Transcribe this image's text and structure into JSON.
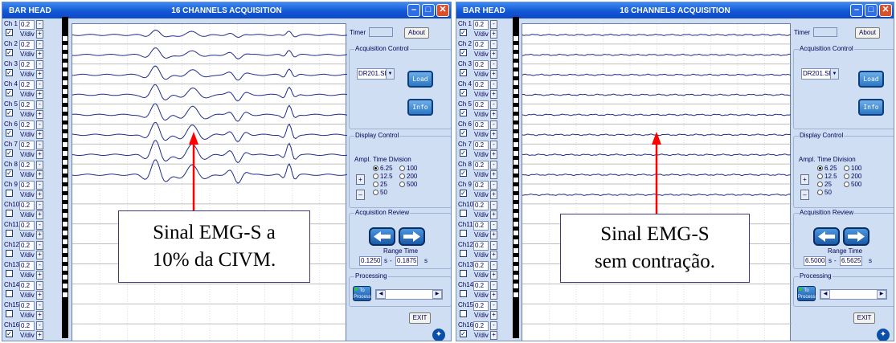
{
  "screens": [
    {
      "app_name": "BAR HEAD",
      "title": "16 CHANNELS ACQUISITION",
      "channels": [
        {
          "label": "Ch 1",
          "amp": "0.2",
          "vdiv": "V/div",
          "checked": true
        },
        {
          "label": "Ch 2",
          "amp": "0.2",
          "vdiv": "V/div",
          "checked": true
        },
        {
          "label": "Ch 3",
          "amp": "0.2",
          "vdiv": "V/div",
          "checked": true
        },
        {
          "label": "Ch 4",
          "amp": "0.2",
          "vdiv": "V/div",
          "checked": true
        },
        {
          "label": "Ch 5",
          "amp": "0.2",
          "vdiv": "V/div",
          "checked": true
        },
        {
          "label": "Ch 6",
          "amp": "0.2",
          "vdiv": "V/div",
          "checked": true
        },
        {
          "label": "Ch 7",
          "amp": "0.2",
          "vdiv": "V/div",
          "checked": true
        },
        {
          "label": "Ch 8",
          "amp": "0.2",
          "vdiv": "V/div",
          "checked": true
        },
        {
          "label": "Ch 9",
          "amp": "0.2",
          "vdiv": "V/div",
          "checked": false
        },
        {
          "label": "Ch10",
          "amp": "0.2",
          "vdiv": "V/div",
          "checked": false
        },
        {
          "label": "Ch11",
          "amp": "0.2",
          "vdiv": "V/div",
          "checked": false
        },
        {
          "label": "Ch12",
          "amp": "0.2",
          "vdiv": "V/div",
          "checked": false
        },
        {
          "label": "Ch13",
          "amp": "0.2",
          "vdiv": "V/div",
          "checked": false
        },
        {
          "label": "Ch14",
          "amp": "0.2",
          "vdiv": "V/div",
          "checked": false
        },
        {
          "label": "Ch15",
          "amp": "0.2",
          "vdiv": "V/div",
          "checked": false
        },
        {
          "label": "Ch16",
          "amp": "0.2",
          "vdiv": "V/div",
          "checked": true
        }
      ],
      "timer_label": "Timer",
      "about_label": "About",
      "acq_control_label": "Acquisition Control",
      "file_select": "DR201.SIG",
      "load_label": "Load",
      "info_label": "Info",
      "display_control_label": "Display Control",
      "ampl_label": "Ampl.",
      "time_division_label": "Time Division",
      "time_options": [
        "6.25",
        "12.5",
        "25",
        "50",
        "100",
        "200",
        "500"
      ],
      "time_selected": "6.25",
      "acq_review_label": "Acquisition Review",
      "range_time_label": "Range Time",
      "range_start": "0.1250",
      "range_end": "0.1875",
      "range_unit": "s",
      "processing_label": "Processing",
      "to_process_label": "To Process",
      "exit_label": "EXIT",
      "caption_lines": [
        "Sinal EMG-S a",
        "10% da CIVM."
      ],
      "signal": "emg-10pct"
    },
    {
      "app_name": "BAR HEAD",
      "title": "16 CHANNELS ACQUISITION",
      "channels": [
        {
          "label": "Ch 1",
          "amp": "0.2",
          "vdiv": "V/div",
          "checked": true
        },
        {
          "label": "Ch 2",
          "amp": "0.2",
          "vdiv": "V/div",
          "checked": true
        },
        {
          "label": "Ch 3",
          "amp": "0.2",
          "vdiv": "V/div",
          "checked": true
        },
        {
          "label": "Ch 4",
          "amp": "0.2",
          "vdiv": "V/div",
          "checked": true
        },
        {
          "label": "Ch 5",
          "amp": "0.2",
          "vdiv": "V/div",
          "checked": true
        },
        {
          "label": "Ch 6",
          "amp": "0.2",
          "vdiv": "V/div",
          "checked": true
        },
        {
          "label": "Ch 7",
          "amp": "0.2",
          "vdiv": "V/div",
          "checked": true
        },
        {
          "label": "Ch 8",
          "amp": "0.2",
          "vdiv": "V/div",
          "checked": true
        },
        {
          "label": "Ch 9",
          "amp": "0.2",
          "vdiv": "V/div",
          "checked": true
        },
        {
          "label": "Ch10",
          "amp": "0.2",
          "vdiv": "V/div",
          "checked": false
        },
        {
          "label": "Ch11",
          "amp": "0.2",
          "vdiv": "V/div",
          "checked": false
        },
        {
          "label": "Ch12",
          "amp": "0.2",
          "vdiv": "V/div",
          "checked": false
        },
        {
          "label": "Ch13",
          "amp": "0.2",
          "vdiv": "V/div",
          "checked": false
        },
        {
          "label": "Ch14",
          "amp": "0.2",
          "vdiv": "V/div",
          "checked": false
        },
        {
          "label": "Ch15",
          "amp": "0.2",
          "vdiv": "V/div",
          "checked": false
        },
        {
          "label": "Ch16",
          "amp": "0.2",
          "vdiv": "V/div",
          "checked": true
        }
      ],
      "timer_label": "Timer",
      "about_label": "About",
      "acq_control_label": "Acquisition Control",
      "file_select": "DR201.SIG",
      "load_label": "Load",
      "info_label": "Info",
      "display_control_label": "Display Control",
      "ampl_label": "Ampl.",
      "time_division_label": "Time Division",
      "time_options": [
        "6.25",
        "12.5",
        "25",
        "50",
        "100",
        "200",
        "500"
      ],
      "time_selected": "6.25",
      "acq_review_label": "Acquisition Review",
      "range_time_label": "Range Time",
      "range_start": "6.5000",
      "range_end": "6.5625",
      "range_unit": "s",
      "processing_label": "Processing",
      "to_process_label": "To Process",
      "exit_label": "EXIT",
      "caption_lines": [
        "Sinal EMG-S",
        "sem contração."
      ],
      "signal": "baseline"
    }
  ],
  "colors": {
    "trace": "#1f2e8a",
    "grid": "#aaaaaa",
    "arrow": "#ff0000",
    "panel": "#cfdef2",
    "title_bar": "#0d4fd0"
  }
}
